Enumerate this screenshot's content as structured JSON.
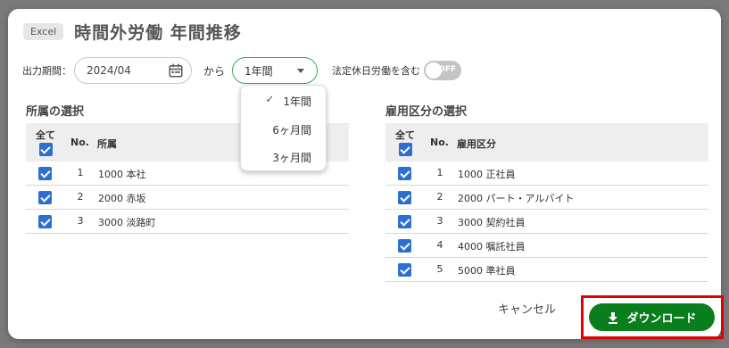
{
  "header": {
    "badge": "Excel",
    "title": "時間外労働 年間推移"
  },
  "period": {
    "label": "出力期間：",
    "date_value": "2024/04",
    "from_label": "から",
    "duration_value": "1年間",
    "holiday_label": "法定休日労働を含む",
    "toggle_text": "OFF",
    "dropdown_options": [
      "1年間",
      "6ヶ月間",
      "3ヶ月間"
    ]
  },
  "affiliation": {
    "title": "所属の選択",
    "col_all": "全て",
    "col_no": "No.",
    "col_name": "所属",
    "rows": [
      {
        "no": "1",
        "name": "1000 本社"
      },
      {
        "no": "2",
        "name": "2000 赤坂"
      },
      {
        "no": "3",
        "name": "3000 淡路町"
      }
    ]
  },
  "employment": {
    "title": "雇用区分の選択",
    "col_all": "全て",
    "col_no": "No.",
    "col_name": "雇用区分",
    "rows": [
      {
        "no": "1",
        "name": "1000 正社員"
      },
      {
        "no": "2",
        "name": "2000 パート・アルバイト"
      },
      {
        "no": "3",
        "name": "3000 契約社員"
      },
      {
        "no": "4",
        "name": "4000 嘱託社員"
      },
      {
        "no": "5",
        "name": "5000 準社員"
      }
    ]
  },
  "footer": {
    "cancel_label": "キャンセル",
    "download_label": "ダウンロード"
  },
  "colors": {
    "accent_green": "#0a7d1c",
    "checkbox_blue": "#2d6fd0",
    "highlight_red": "#e00000"
  }
}
